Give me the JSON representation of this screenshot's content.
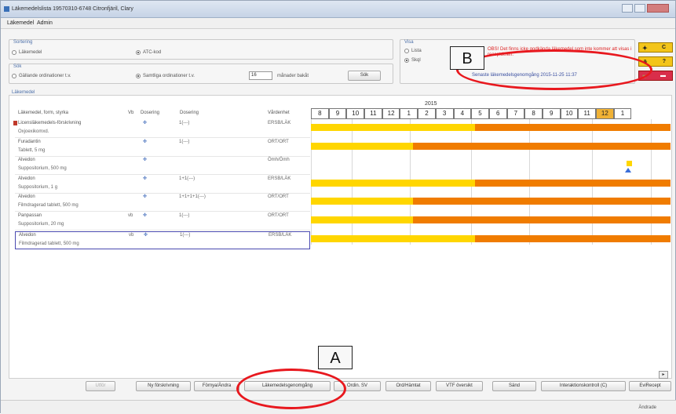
{
  "window": {
    "title": "Läkemedelslista 19570310-6748 Citronfjäril, Clary"
  },
  "menu": [
    "Läkemedel",
    "Admin"
  ],
  "sortering": {
    "label": "Sortering",
    "options": [
      {
        "label": "Läkemedel",
        "selected": false
      },
      {
        "label": "ATC-kod",
        "selected": true
      }
    ]
  },
  "sok": {
    "label": "Sök",
    "options": [
      {
        "label": "Gällande ordinationer t.v.",
        "selected": false
      },
      {
        "label": "Samtliga ordinationer t.v.",
        "selected": true
      }
    ],
    "months_value": "16",
    "months_label": "månader bakåt",
    "button": "Sök"
  },
  "visa": {
    "label": "Visa",
    "options": [
      {
        "label": "Lista",
        "selected": false
      },
      {
        "label": "Skql",
        "selected": true
      }
    ]
  },
  "warning_text": "OBS! Det finns icke godkända läkemedel som inte kommer att visas i receptdelen.",
  "latest_review": "Senaste läkemedelsgenomgång 2015-11-25 11:37",
  "side_buttons": [
    {
      "icon": "pills-icon",
      "label": "C",
      "color": "#f3c51a"
    },
    {
      "icon": "question-icon",
      "label": "?",
      "color": "#f3c51a"
    },
    {
      "icon": "warning-icon",
      "label": "",
      "color": "#d92e4a"
    }
  ],
  "section_label": "Läkemedel",
  "table_headers": [
    "Läkemedel, form, styrka",
    "Vb",
    "Dosering",
    "Dosering",
    "Vårdenhet"
  ],
  "timeline": {
    "year": "2015",
    "months": [
      "8",
      "9",
      "10",
      "11",
      "12",
      "1",
      "2",
      "3",
      "4",
      "5",
      "6",
      "7",
      "8",
      "9",
      "10",
      "11",
      "12",
      "1"
    ],
    "highlight_index": 16
  },
  "rows": [
    {
      "name": "Licensläkemedels-förskrivning",
      "desc": "Oxjoexikomxd.",
      "vb": "",
      "dose": "1(---)",
      "unit": "ERSB/LÄK",
      "flag": true,
      "bar_yellow_pct": 45.7,
      "bar_orange_pct": 54.3
    },
    {
      "name": "Furadantin",
      "desc": "Tablett, 5 mg",
      "vb": "",
      "dose": "1(---)",
      "unit": "ORT/ORT",
      "flag": false,
      "bar_yellow_pct": 28.3,
      "bar_orange_pct": 71.7
    },
    {
      "name": "Alvedon",
      "desc": "Suppositorium, 500 mg",
      "vb": "",
      "dose": "",
      "unit": "Ömh/Ömh",
      "flag": false,
      "bar_yellow_pct": 0,
      "bar_orange_pct": 0
    },
    {
      "name": "Alvedon",
      "desc": "Suppositorium, 1 g",
      "vb": "",
      "dose": "1+1(---)",
      "unit": "ERSB/LÄK",
      "flag": false,
      "bar_yellow_pct": 45.7,
      "bar_orange_pct": 54.3
    },
    {
      "name": "Alvedon",
      "desc": "Filmdragerad tablett, 500 mg",
      "vb": "",
      "dose": "1+1+1+1(---)",
      "unit": "ORT/ORT",
      "flag": false,
      "bar_yellow_pct": 28.3,
      "bar_orange_pct": 71.7
    },
    {
      "name": "Panpassan",
      "desc": "Suppositorium, 20 mg",
      "vb": "vb",
      "dose": "1(---)",
      "unit": "ORT/ORT",
      "flag": false,
      "bar_yellow_pct": 28.3,
      "bar_orange_pct": 71.7
    },
    {
      "name": "Alvedon",
      "desc": "Filmdragerad tablett, 500 mg",
      "vb": "vb",
      "dose": "1(---)",
      "unit": "ERSB/LÄK",
      "flag": false,
      "bar_yellow_pct": 45.7,
      "bar_orange_pct": 54.3,
      "selected": true
    }
  ],
  "bottom_buttons": [
    "Utför",
    "Ny förskrivning",
    "Förnya/Ändra",
    "Läkemedelsgenomgång",
    "Ordin. SV",
    "Ord/Hämtat",
    "VTF översikt",
    "Sänd",
    "Interaktionskontroll (C)",
    "EviRecept"
  ],
  "status_text": "Ändrade",
  "callouts": [
    "A",
    "B"
  ]
}
